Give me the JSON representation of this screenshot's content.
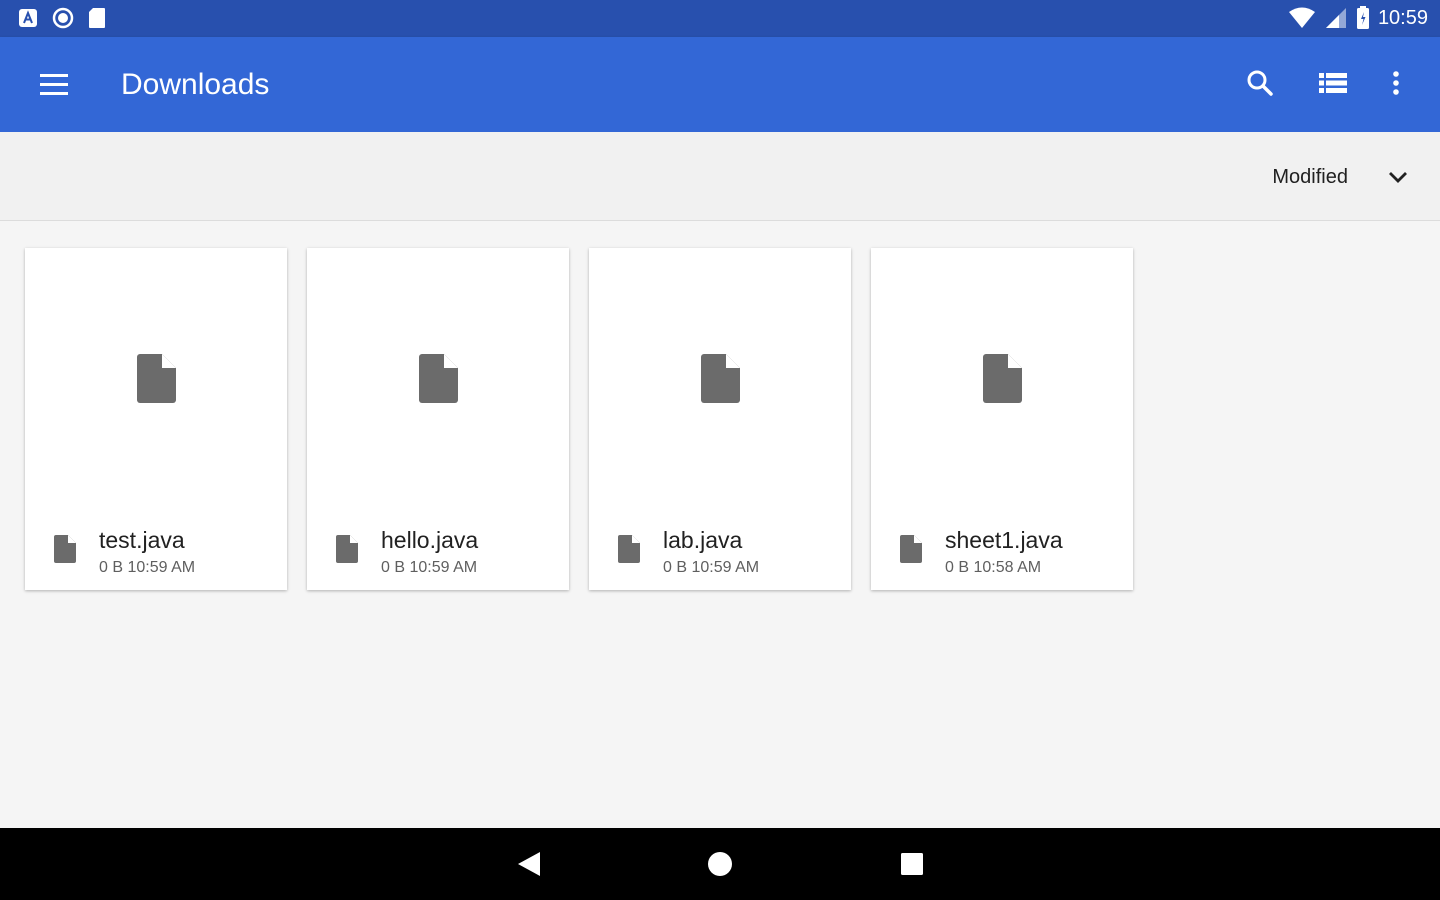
{
  "status_bar": {
    "time": "10:59",
    "left_icons": [
      "app-notification-icon",
      "sync-notification-icon",
      "sd-card-icon"
    ],
    "right_icons": [
      "wifi-icon",
      "cellular-signal-icon",
      "battery-icon"
    ]
  },
  "app_bar": {
    "title": "Downloads",
    "background": "#3367d6",
    "actions": [
      "search-icon",
      "list-view-icon",
      "more-options-icon"
    ]
  },
  "sort_bar": {
    "label": "Modified"
  },
  "files": [
    {
      "name": "test.java",
      "meta": "0 B  10:59 AM"
    },
    {
      "name": "hello.java",
      "meta": "0 B  10:59 AM"
    },
    {
      "name": "lab.java",
      "meta": "0 B  10:59 AM"
    },
    {
      "name": "sheet1.java",
      "meta": "0 B  10:58 AM"
    }
  ],
  "nav_bar": {
    "buttons": [
      "back-icon",
      "home-icon",
      "recents-icon"
    ]
  }
}
